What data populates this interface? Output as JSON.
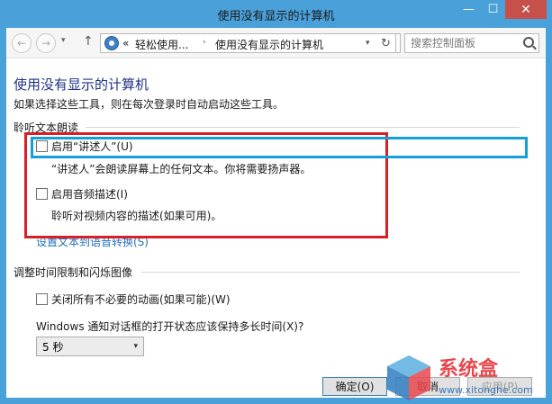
{
  "window": {
    "title": "使用没有显示的计算机",
    "minimize": "—",
    "maximize": "☐",
    "close": "✕"
  },
  "nav": {
    "back": "←",
    "forward": "→",
    "dropdown": "▾",
    "up": "↑",
    "chevron": "«",
    "breadcrumb": [
      "轻松使用...",
      "使用没有显示的计算机"
    ],
    "separator": "›",
    "address_dropdown": "▾",
    "refresh": "↻",
    "search_placeholder": "搜索控制面板"
  },
  "page": {
    "title": "使用没有显示的计算机",
    "subtitle": "如果选择这些工具，则在每次登录时自动启动这些工具。"
  },
  "section_narrator": {
    "header": "聆听文本朗读",
    "enable_narrator": "启用“讲述人”(U)",
    "narrator_desc": "“讲述人”会朗读屏幕上的任何文本。你将需要扬声器。",
    "enable_audio_desc": "启用音频描述(I)",
    "audio_desc_desc": "聆听对视频内容的描述(如果可用)。",
    "tts_link": "设置文本到语音转换(S)"
  },
  "section_timing": {
    "header": "调整时间限制和闪烁图像",
    "disable_animations": "关闭所有不必要的动画(如果可能)(W)",
    "notify_label": "Windows 通知对话框的打开状态应该保持多长时间(X)?",
    "notify_value": "5 秒",
    "select_arrow": "▾"
  },
  "footer": {
    "ok": "确定(O)",
    "cancel": "取消",
    "apply": "应用(P)"
  },
  "watermark": {
    "name": "系统盒",
    "url": "www.xitonghe.com"
  },
  "colors": {
    "titlebar": "#4aa0d9",
    "close": "#c7504a",
    "page_title": "#1e3287",
    "link": "#1f6fbf",
    "annotation_red": "#d61f26",
    "annotation_blue": "#13a0d6"
  }
}
